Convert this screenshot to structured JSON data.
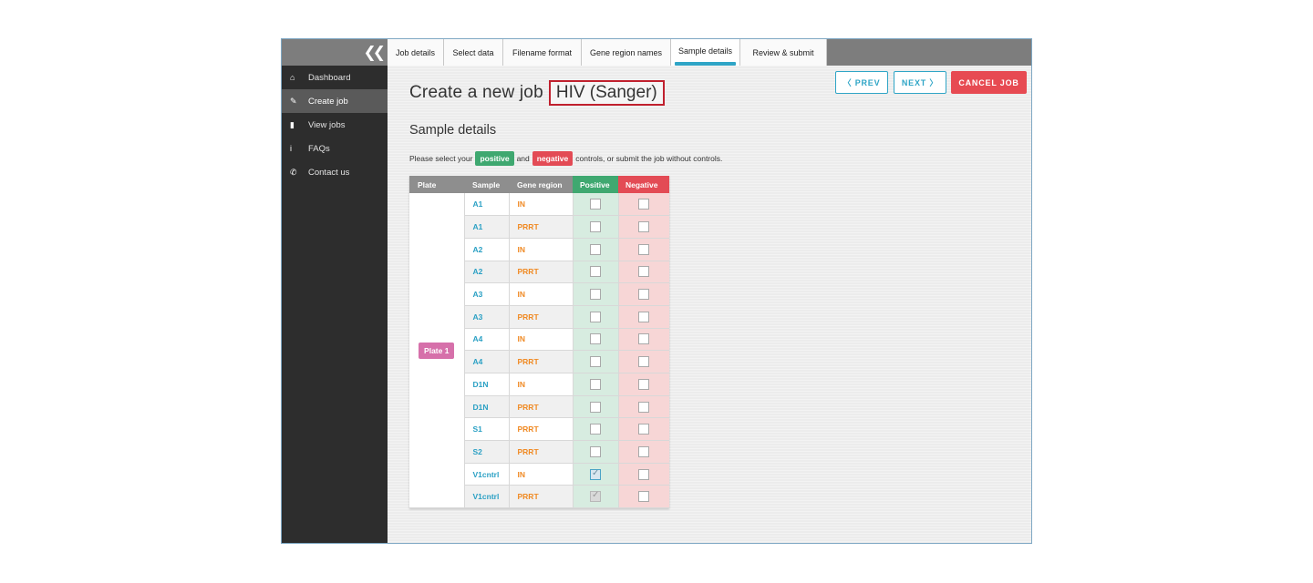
{
  "sidebar": {
    "collapse_glyph": "❮❮",
    "items": [
      {
        "label": "Dashboard",
        "icon": "home-icon",
        "glyph": "⌂",
        "active": false
      },
      {
        "label": "Create job",
        "icon": "create-job-icon",
        "glyph": "✎",
        "active": true
      },
      {
        "label": "View jobs",
        "icon": "bar-chart-icon",
        "glyph": "▮",
        "active": false
      },
      {
        "label": "FAQs",
        "icon": "info-icon",
        "glyph": "i",
        "active": false
      },
      {
        "label": "Contact us",
        "icon": "phone-icon",
        "glyph": "✆",
        "active": false
      }
    ]
  },
  "tabs": [
    {
      "label": "Job details",
      "active": false
    },
    {
      "label": "Select data",
      "active": false
    },
    {
      "label": "Filename format",
      "active": false
    },
    {
      "label": "Gene region names",
      "active": false
    },
    {
      "label": "Sample details",
      "active": true
    },
    {
      "label": "Review & submit",
      "active": false
    }
  ],
  "header": {
    "title": "Create a new job",
    "job_type": "HIV (Sanger)"
  },
  "buttons": {
    "prev": "〈  PREV",
    "next": "NEXT  〉",
    "cancel": "CANCEL JOB"
  },
  "section": {
    "title": "Sample details",
    "instruction_pre": "Please select your",
    "positive_tag": "positive",
    "instruction_mid": "and",
    "negative_tag": "negative",
    "instruction_post": "controls, or submit the job without controls."
  },
  "table": {
    "headers": {
      "plate": "Plate",
      "sample": "Sample",
      "gene": "Gene region",
      "positive": "Positive",
      "negative": "Negative"
    },
    "plate_label": "Plate 1",
    "rows": [
      {
        "sample": "A1",
        "gene": "IN",
        "positive": "unchecked",
        "negative": "unchecked"
      },
      {
        "sample": "A1",
        "gene": "PRRT",
        "positive": "unchecked",
        "negative": "unchecked"
      },
      {
        "sample": "A2",
        "gene": "IN",
        "positive": "unchecked",
        "negative": "unchecked"
      },
      {
        "sample": "A2",
        "gene": "PRRT",
        "positive": "unchecked",
        "negative": "unchecked"
      },
      {
        "sample": "A3",
        "gene": "IN",
        "positive": "unchecked",
        "negative": "unchecked"
      },
      {
        "sample": "A3",
        "gene": "PRRT",
        "positive": "unchecked",
        "negative": "unchecked"
      },
      {
        "sample": "A4",
        "gene": "IN",
        "positive": "unchecked",
        "negative": "unchecked"
      },
      {
        "sample": "A4",
        "gene": "PRRT",
        "positive": "unchecked",
        "negative": "unchecked"
      },
      {
        "sample": "D1N",
        "gene": "IN",
        "positive": "unchecked",
        "negative": "unchecked"
      },
      {
        "sample": "D1N",
        "gene": "PRRT",
        "positive": "unchecked",
        "negative": "unchecked"
      },
      {
        "sample": "S1",
        "gene": "PRRT",
        "positive": "unchecked",
        "negative": "unchecked"
      },
      {
        "sample": "S2",
        "gene": "PRRT",
        "positive": "unchecked",
        "negative": "unchecked"
      },
      {
        "sample": "V1cntrl",
        "gene": "IN",
        "positive": "checked",
        "negative": "unchecked"
      },
      {
        "sample": "V1cntrl",
        "gene": "PRRT",
        "positive": "checked-disabled",
        "negative": "unchecked"
      }
    ]
  },
  "colors": {
    "accent": "#2fa5c6",
    "positive": "#3fa870",
    "negative": "#e34b55",
    "plate": "#d670aa",
    "gene": "#f08a24",
    "cancel": "#e74a52",
    "highlight_border": "#c0202e"
  }
}
